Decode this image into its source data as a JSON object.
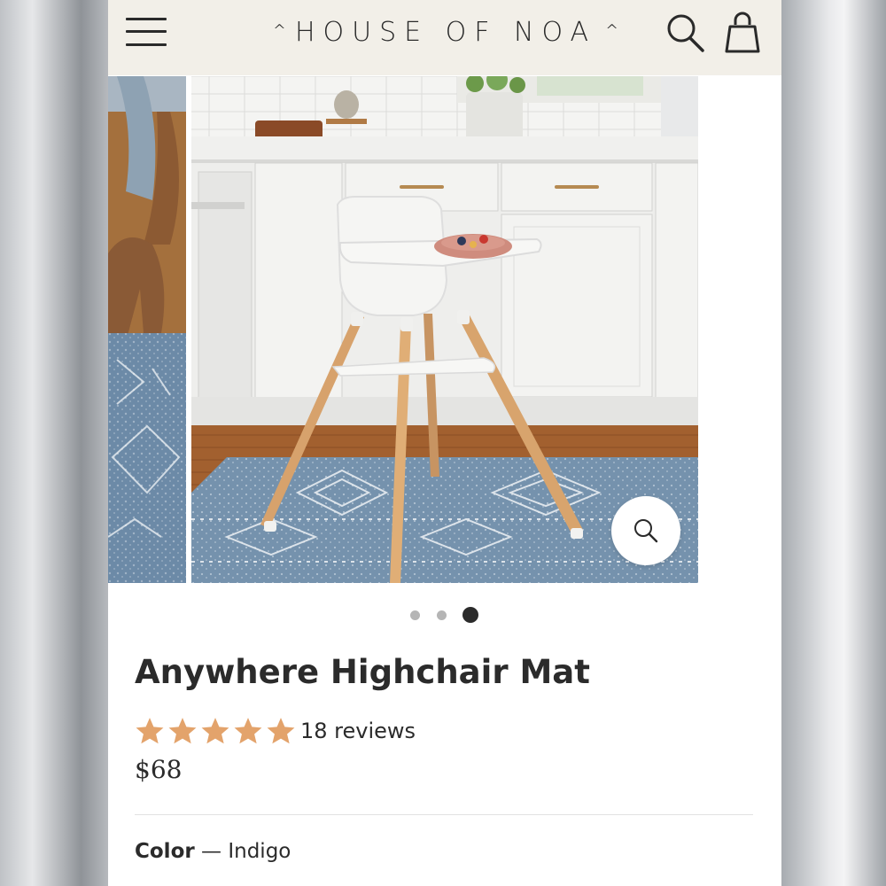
{
  "header": {
    "brand": "HOUSE OF NOA",
    "menu_icon": "hamburger-menu-icon",
    "search_icon": "search-icon",
    "cart_icon": "shopping-bag-icon"
  },
  "gallery": {
    "slide_count": 3,
    "active_slide": 3,
    "zoom_icon": "zoom-icon"
  },
  "product": {
    "title": "Anywhere Highchair Mat",
    "rating": 5,
    "rating_max": 5,
    "reviews_label": "18 reviews",
    "price": "$68",
    "color_label": "Color",
    "color_separator": "—",
    "color_value": "Indigo"
  },
  "colors": {
    "header_bg": "#f2efe8",
    "star": "#e3a36b",
    "text": "#2b2b2b",
    "dot_active": "#2b2b2b",
    "dot_inactive": "#b5b5b5"
  }
}
